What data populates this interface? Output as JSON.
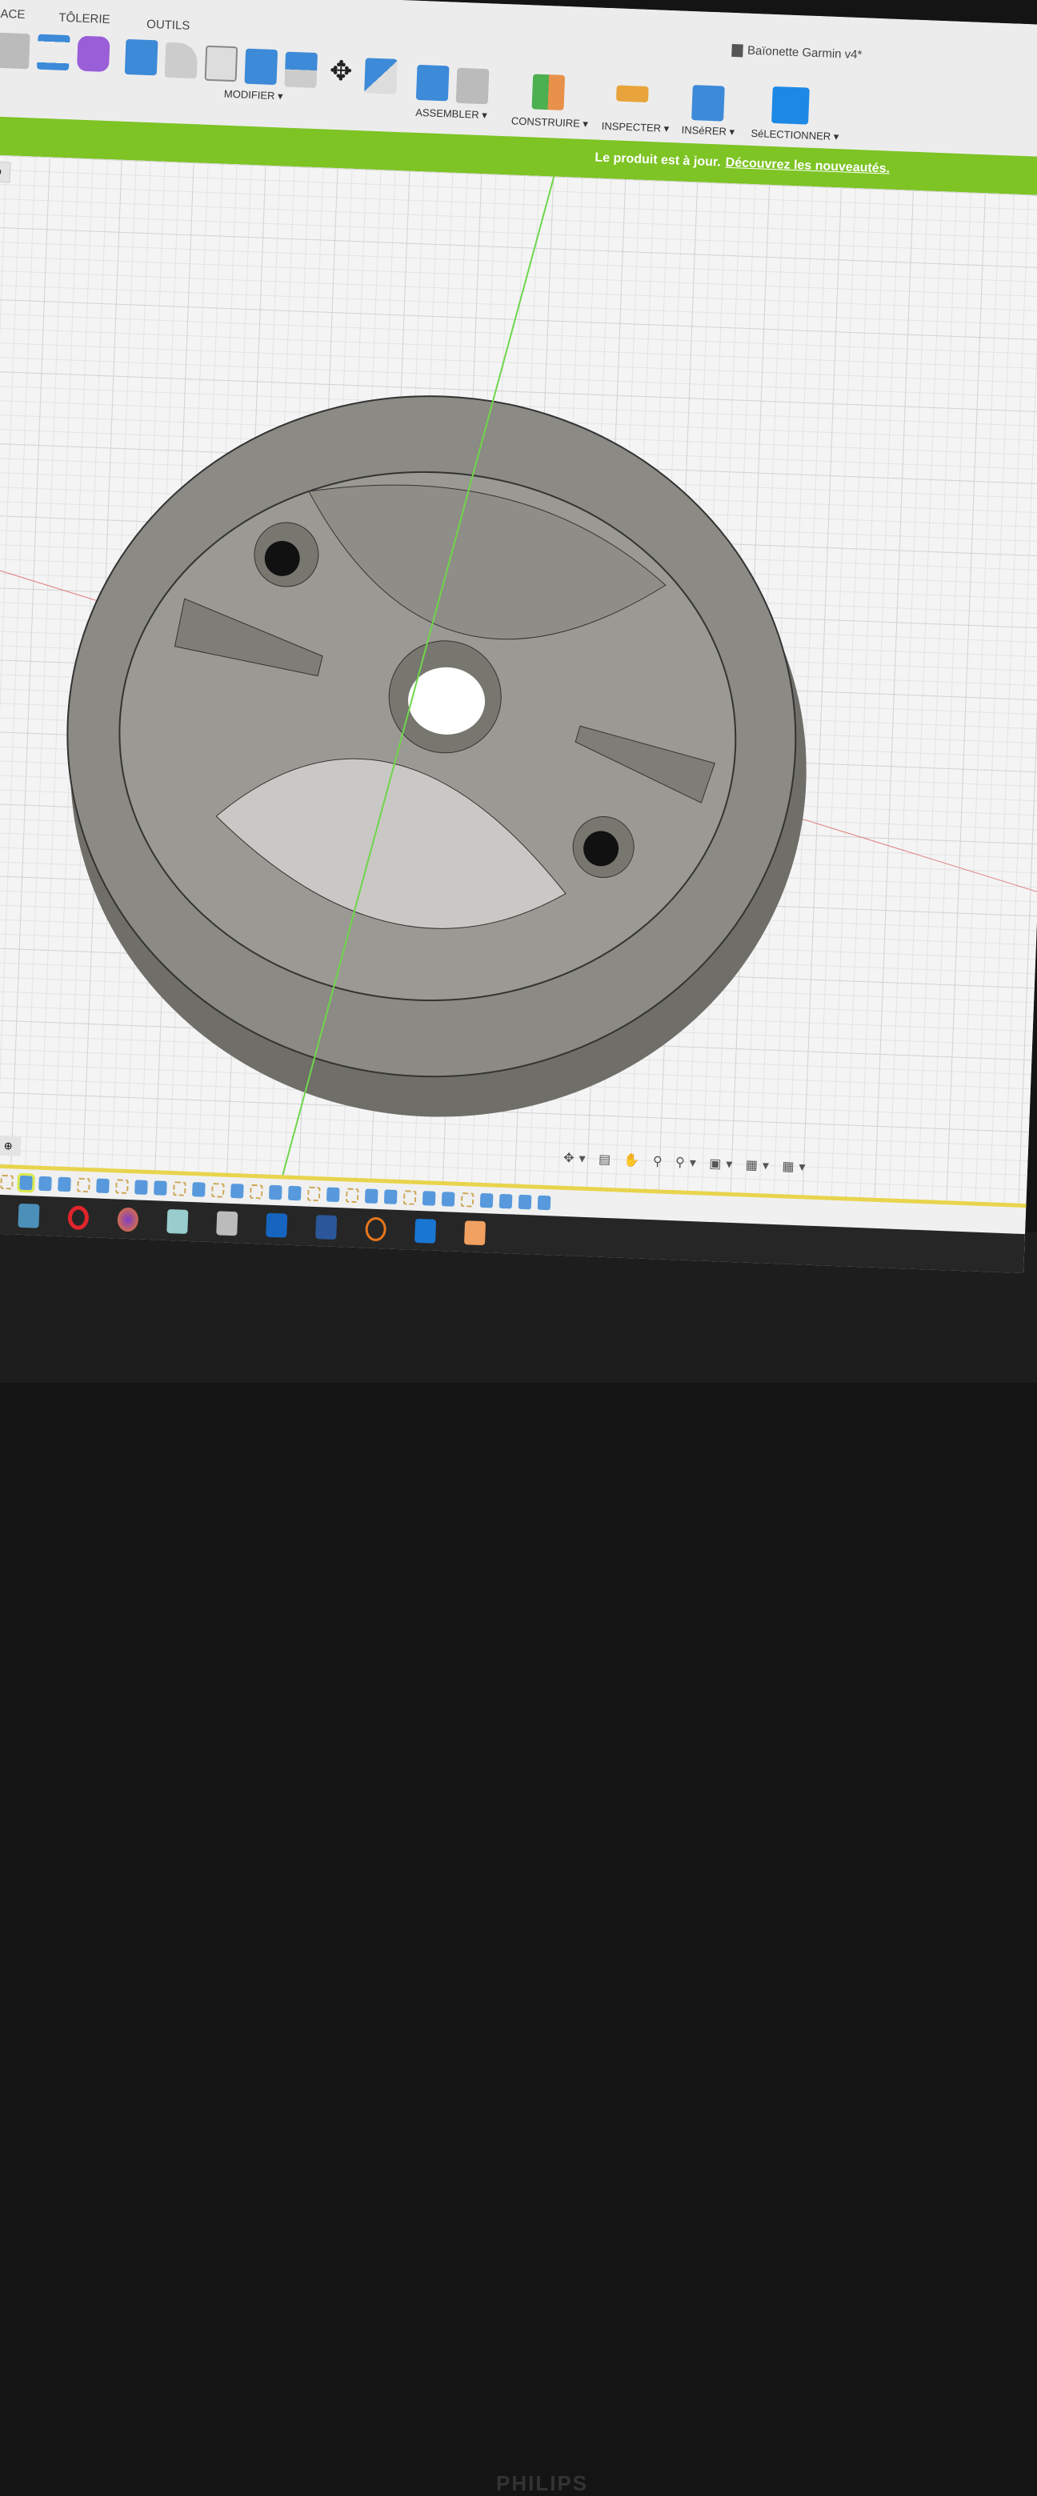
{
  "toolbar": {
    "tabs": [
      "ACE",
      "TÔLERIE",
      "OUTILS"
    ],
    "groups": {
      "modify": "MODIFIER ▾",
      "assemble": "ASSEMBLER ▾",
      "construct": "CONSTRUIRE ▾",
      "inspect": "INSPECTER ▾",
      "insert": "INSéRER ▾",
      "select": "SéLECTIONNER ▾"
    }
  },
  "document": {
    "title": "Baïonette Garmin v4*"
  },
  "banner": {
    "message": "Le produit est à jour.",
    "link": "Découvrez les nouveautés."
  },
  "colors": {
    "banner": "#7dc424",
    "accent": "#1e88e5",
    "part": "#8a8882"
  },
  "monitor": {
    "brand": "PHILIPS"
  }
}
